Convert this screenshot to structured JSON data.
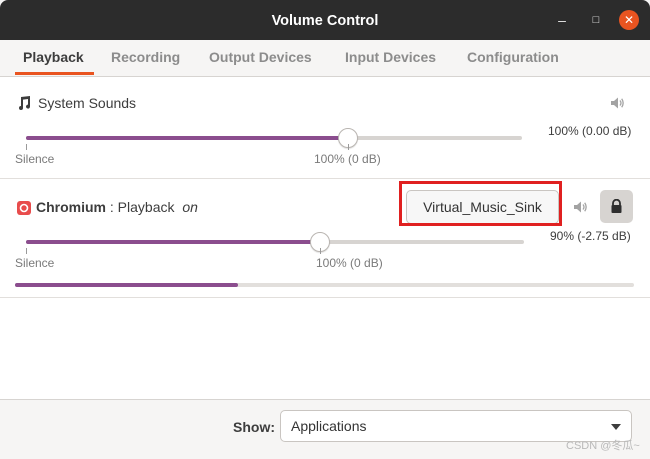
{
  "window": {
    "title": "Volume Control"
  },
  "tabs": [
    {
      "label": "Playback",
      "active": true
    },
    {
      "label": "Recording",
      "active": false
    },
    {
      "label": "Output Devices",
      "active": false
    },
    {
      "label": "Input Devices",
      "active": false
    },
    {
      "label": "Configuration",
      "active": false
    }
  ],
  "system_sounds": {
    "name": "System Sounds",
    "icon": "music-note-icon",
    "level_text": "100% (0.00 dB)",
    "level_fraction": 0.65,
    "label_silence": "Silence",
    "label_100": "100% (0 dB)"
  },
  "stream": {
    "app_name": "Chromium",
    "separator": ":",
    "stream_name": "Playback",
    "state": "on",
    "device_button": "Virtual_Music_Sink",
    "level_text": "90% (-2.75 dB)",
    "level_fraction": 0.59,
    "label_silence": "Silence",
    "label_100": "100% (0 dB)",
    "peak_fraction": 0.36,
    "icon": "chromium-icon"
  },
  "footer": {
    "show_label": "Show:",
    "show_value": "Applications"
  },
  "watermark": "CSDN @冬瓜~",
  "colors": {
    "accent": "#e95420",
    "slider": "#8b4d8e",
    "highlight": "#e02020"
  }
}
